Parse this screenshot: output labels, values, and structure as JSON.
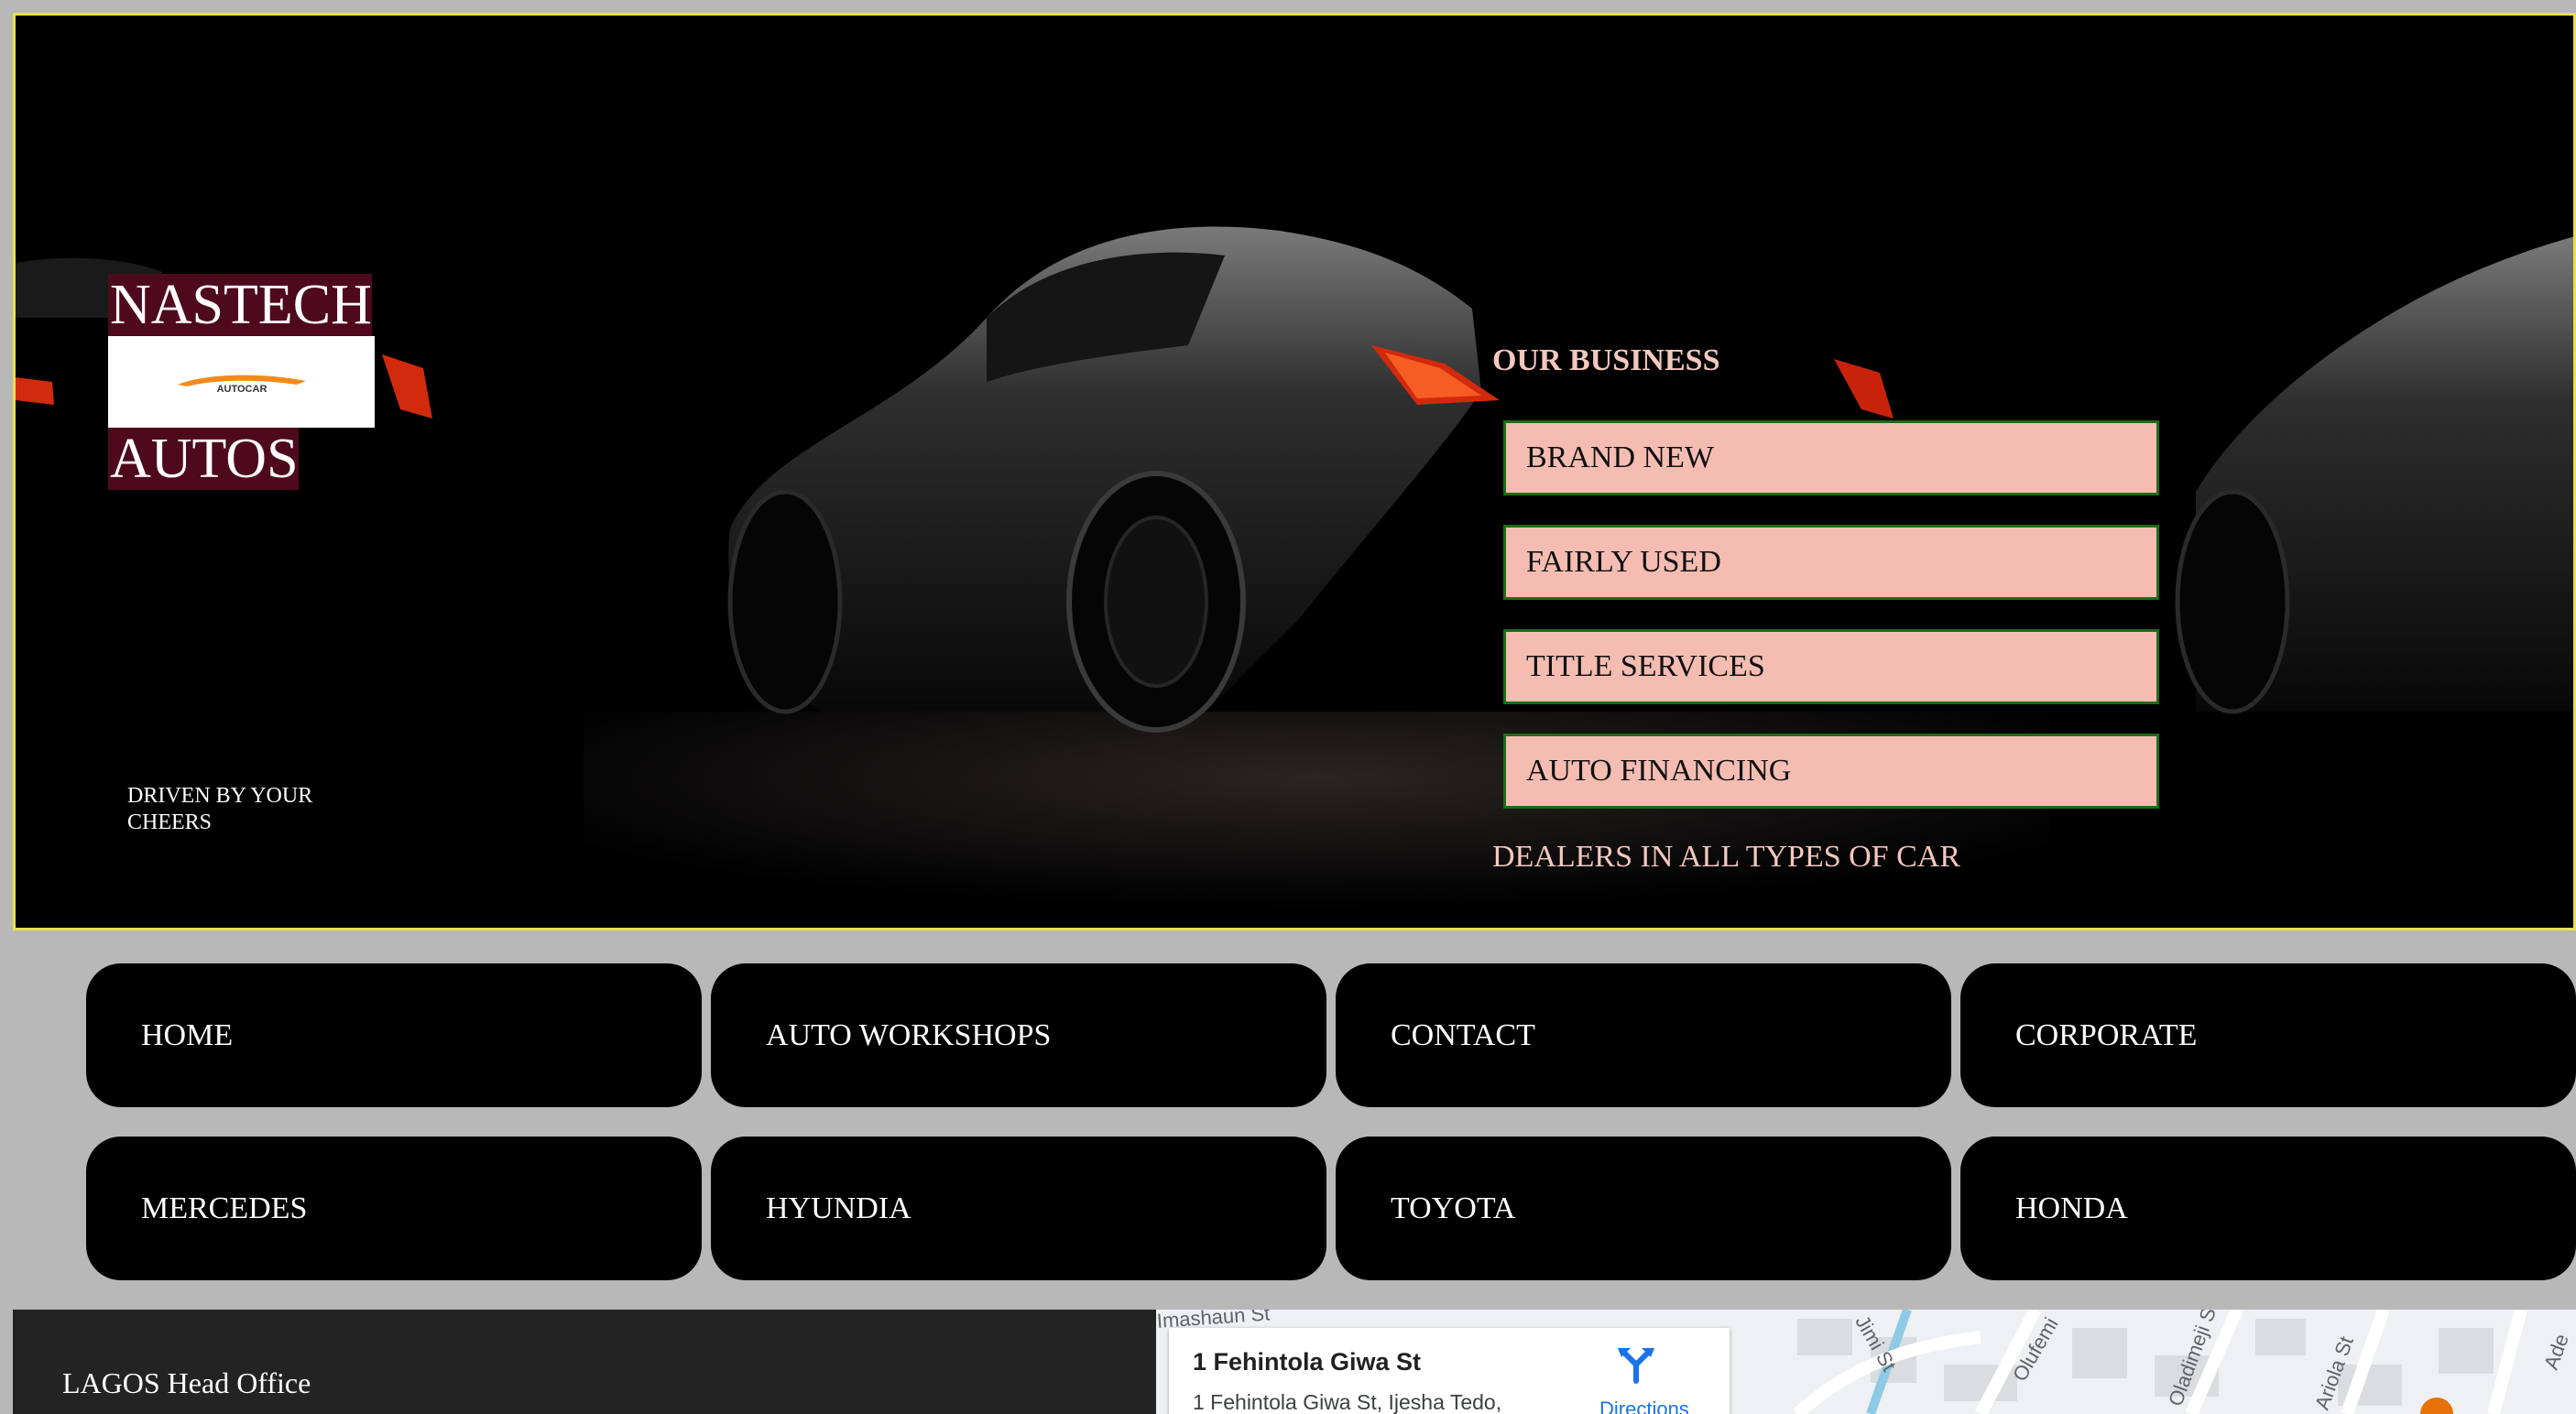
{
  "hero": {
    "brand_line1": "NASTECH",
    "brand_line2": "AUTOS",
    "logo_text": "AUTOCAR",
    "tagline": "DRIVEN BY YOUR CHEERS",
    "business_heading": "OUR BUSINESS",
    "business_items": [
      "BRAND NEW",
      "FAIRLY USED",
      "TITLE SERVICES",
      "AUTO FINANCING"
    ],
    "dealers_text": "DEALERS IN ALL TYPES OF CAR"
  },
  "nav": {
    "row1": [
      "HOME",
      "AUTO WORKSHOPS",
      "CONTACT",
      "CORPORATE"
    ],
    "row2": [
      "MERCEDES",
      "HYUNDIA",
      "TOYOTA",
      "HONDA"
    ]
  },
  "footer": {
    "office_label": "LAGOS Head Office"
  },
  "map": {
    "place_title": "1 Fehintola Giwa St",
    "place_address": "1 Fehintola Giwa St, Ijesha Tedo,",
    "directions_label": "Directions",
    "streets": [
      "Imashaun St",
      "Jimi St",
      "Olufemi",
      "Oladimeji St",
      "Ariola St",
      "Ade"
    ]
  },
  "colors": {
    "page_bg": "#b8b8b8",
    "hero_border": "#e5e24a",
    "brand_bg": "#4e0a1c",
    "business_btn_bg": "#f5bdb2",
    "business_btn_border": "#1f6b16",
    "heading_pink": "#f4c8bd",
    "nav_bg": "#000000"
  }
}
